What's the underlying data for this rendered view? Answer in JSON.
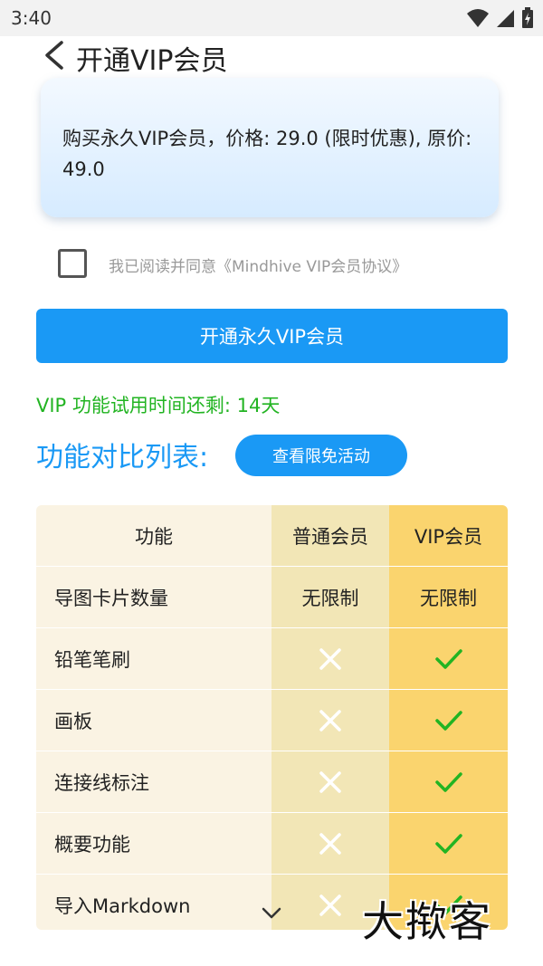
{
  "status_bar": {
    "time": "3:40",
    "icons": [
      "wifi-icon",
      "signal-icon",
      "battery-charging-icon"
    ]
  },
  "nav": {
    "title": "开通VIP会员",
    "back_icon": "chevron-left-icon"
  },
  "price_card": {
    "text": "购买永久VIP会员，价格: 29.0 (限时优惠), 原价: 49.0"
  },
  "agreement": {
    "checked": false,
    "text": "我已阅读并同意《Mindhive VIP会员协议》"
  },
  "buy_button": {
    "label": "开通永久VIP会员"
  },
  "trial": {
    "text": "VIP 功能试用时间还剩: 14天"
  },
  "compare": {
    "title": "功能对比列表:",
    "promo_button": "查看限免活动"
  },
  "table": {
    "headers": [
      "功能",
      "普通会员",
      "VIP会员"
    ],
    "rows": [
      {
        "feature": "导图卡片数量",
        "normal": "无限制",
        "vip": "无限制"
      },
      {
        "feature": "铅笔笔刷",
        "normal": "cross-icon",
        "vip": "check-icon"
      },
      {
        "feature": "画板",
        "normal": "cross-icon",
        "vip": "check-icon"
      },
      {
        "feature": "连接线标注",
        "normal": "cross-icon",
        "vip": "check-icon"
      },
      {
        "feature": "概要功能",
        "normal": "cross-icon",
        "vip": "check-icon"
      },
      {
        "feature": "导入Markdown",
        "normal": "cross-icon",
        "vip": "check-icon"
      }
    ]
  },
  "scroll_hint_icon": "chevron-down-icon",
  "watermark": {
    "text": "大揿客"
  },
  "colors": {
    "accent": "#1a99f5",
    "trial_green": "#22b422",
    "check_green": "#22b422",
    "cross_white": "#ffffff",
    "feature_col": "#faf3e3",
    "normal_col": "#f2e6b6",
    "vip_col": "#fad46e"
  }
}
